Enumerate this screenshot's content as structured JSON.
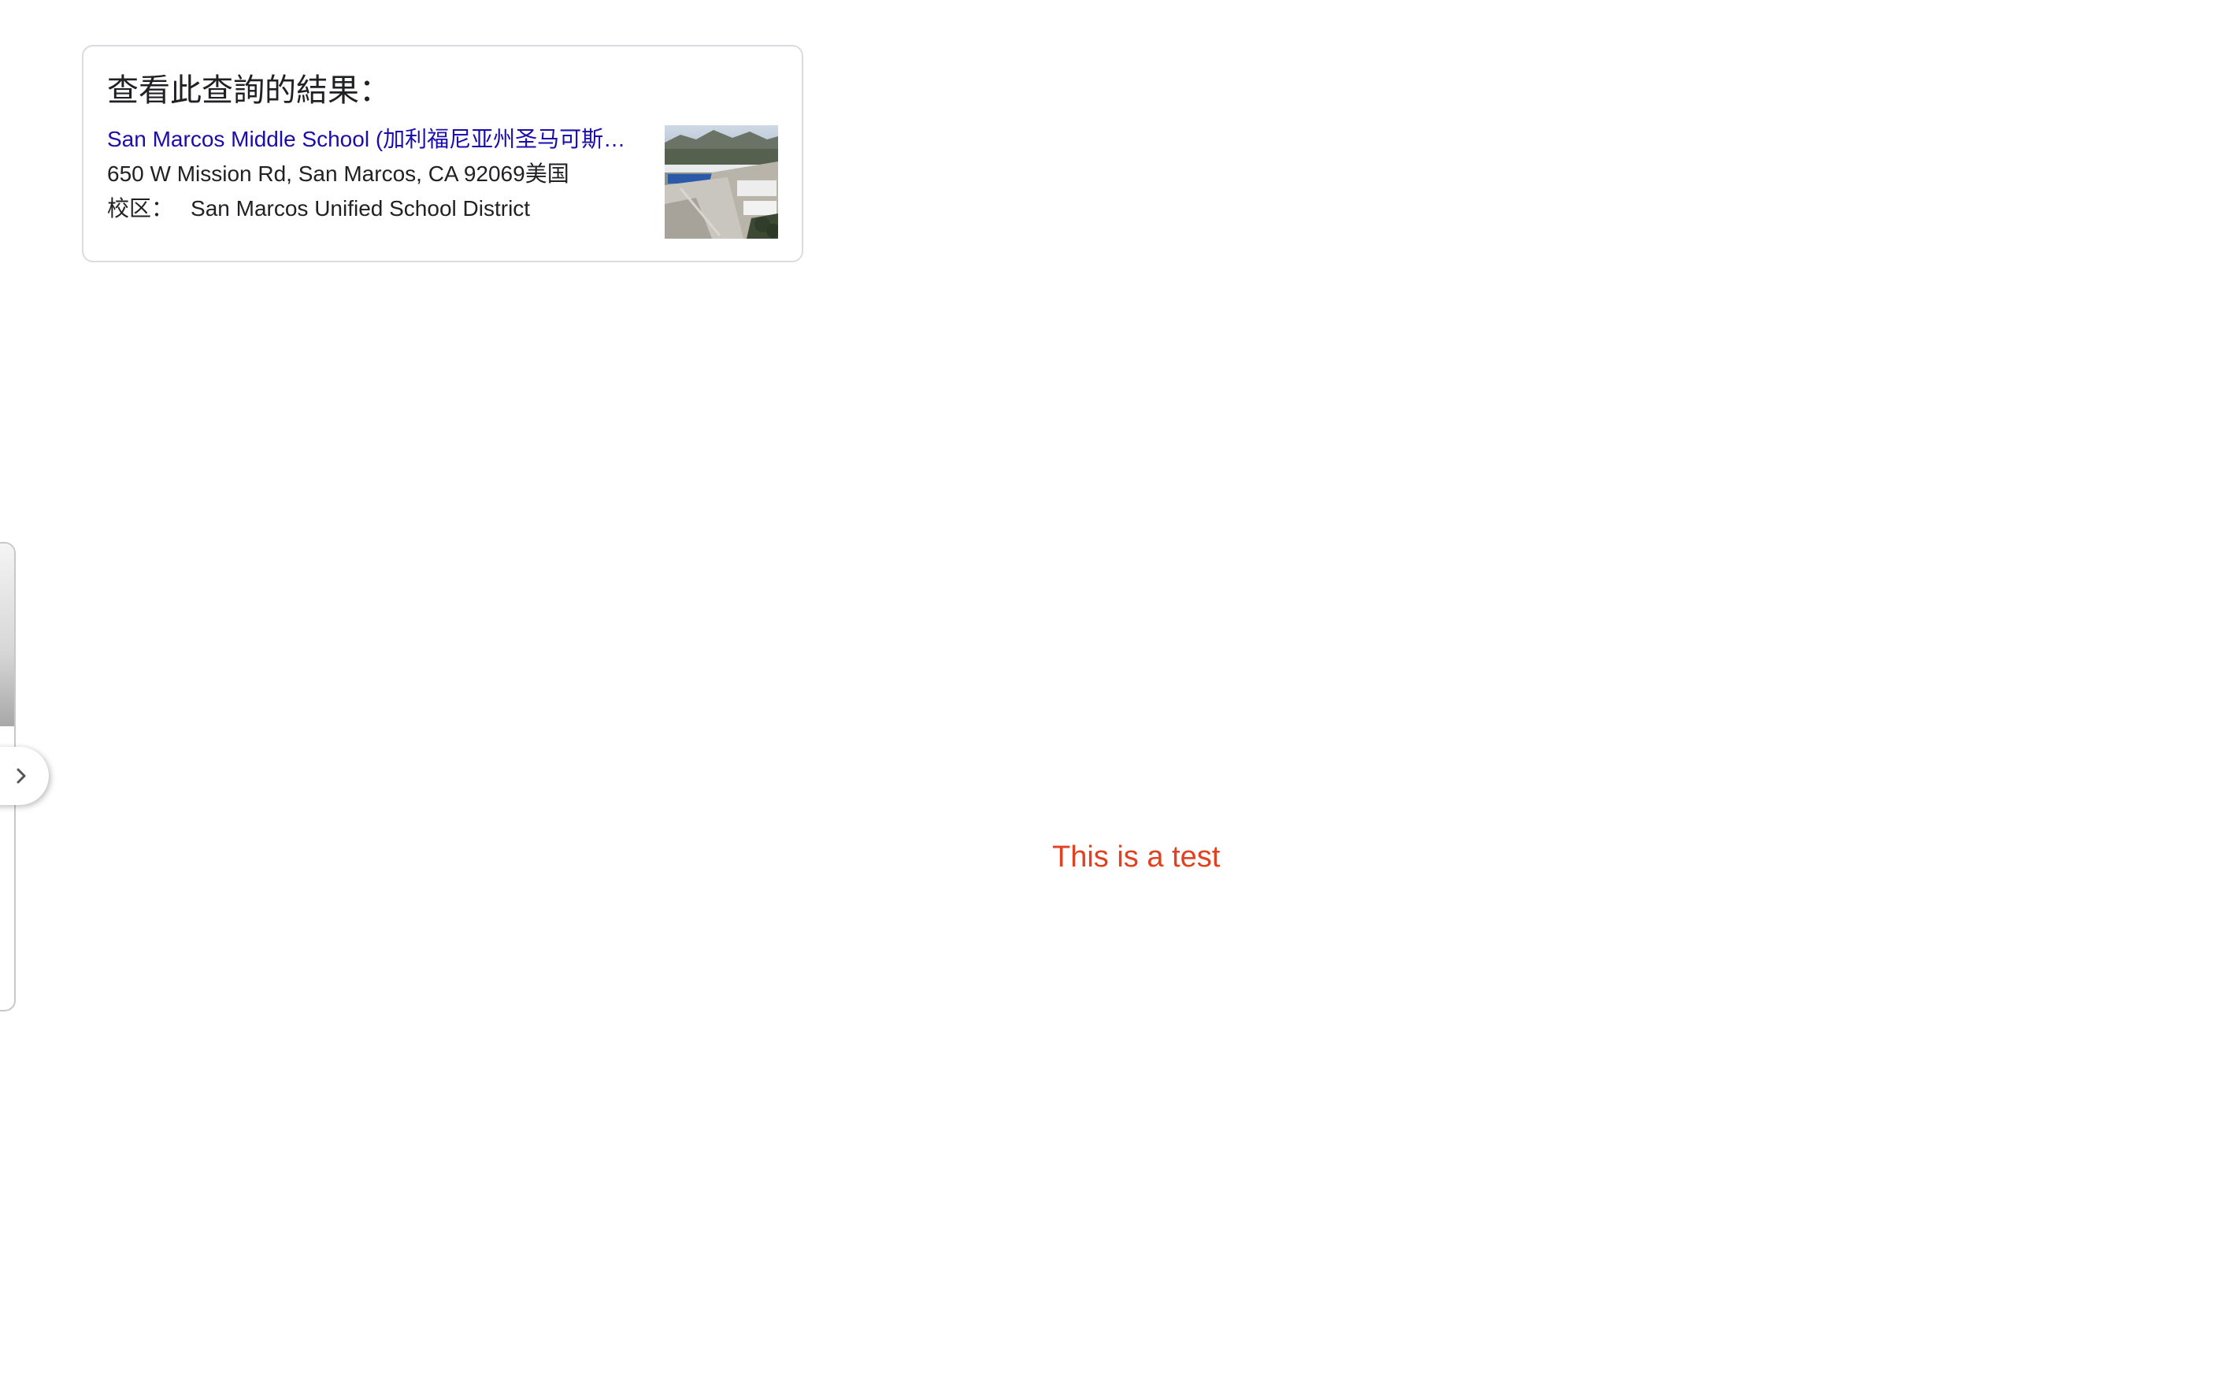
{
  "result_card": {
    "title": "查看此查詢的結果：",
    "link": "San Marcos Middle School (加利福尼亚州圣马可斯…",
    "address": "650 W Mission Rd, San Marcos, CA 92069美国",
    "district_label": "校区：",
    "district_value": "San Marcos Unified School District"
  },
  "main": {
    "message": "This is a test",
    "message_color": "#e2401f"
  },
  "side_panel": {
    "handle_icon": "chevron-right-icon"
  }
}
